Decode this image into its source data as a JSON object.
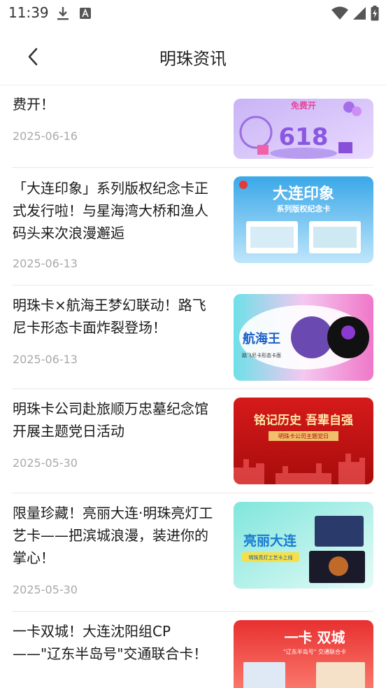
{
  "status_bar": {
    "time": "11:39"
  },
  "header": {
    "title": "明珠资讯"
  },
  "articles": [
    {
      "title": "费开！",
      "date": "2025-06-16",
      "thumb_text": "免费开",
      "thumb_big": "618"
    },
    {
      "title": "「大连印象」系列版权纪念卡正式发行啦！与星海湾大桥和渔人码头来次浪漫邂逅",
      "date": "2025-06-13",
      "thumb_text": "大连印象",
      "thumb_sub": "系列版权纪念卡"
    },
    {
      "title": "明珠卡×航海王梦幻联动！路飞尼卡形态卡面炸裂登场！",
      "date": "2025-06-13",
      "thumb_text": "航海王",
      "thumb_sub": "路飞尼卡形态卡面"
    },
    {
      "title": "明珠卡公司赴旅顺万忠墓纪念馆开展主题党日活动",
      "date": "2025-05-30",
      "thumb_text": "铭记历史 吾辈自强",
      "thumb_sub": "明珠卡公司主题党日"
    },
    {
      "title": "限量珍藏！亮丽大连·明珠亮灯工艺卡——把滨城浪漫，装进你的掌心！",
      "date": "2025-05-30",
      "thumb_text": "亮丽大连",
      "thumb_sub": "明珠亮灯工艺卡上线"
    },
    {
      "title": "一卡双城！大连沈阳组CP——\"辽东半岛号\"交通联合卡！",
      "date": "",
      "thumb_text": "一卡 双城",
      "thumb_sub": "\"辽东半岛号\" 交通联合卡"
    }
  ]
}
